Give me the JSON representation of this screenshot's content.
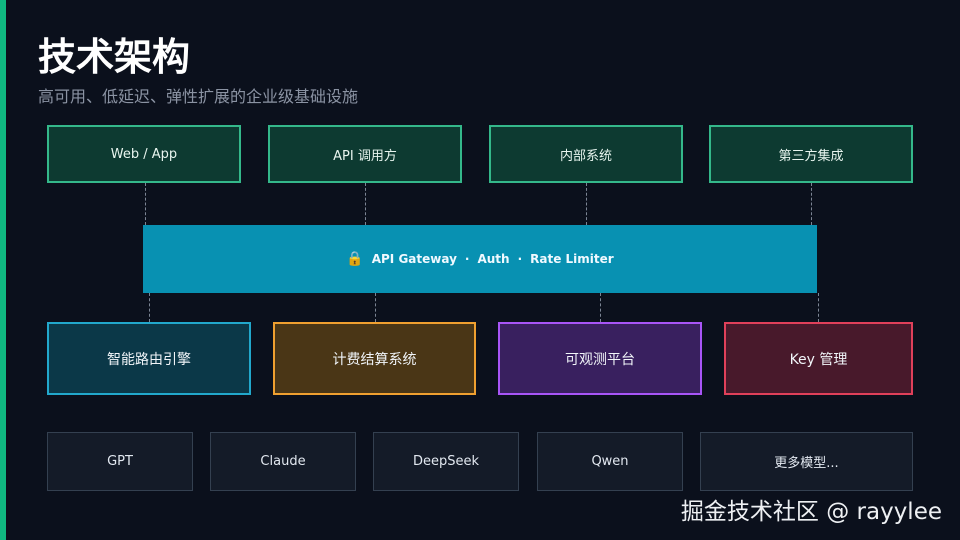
{
  "header": {
    "title": "技术架构",
    "subtitle": "高可用、低延迟、弹性扩展的企业级基础设施"
  },
  "clients": [
    "Web / App",
    "API 调用方",
    "内部系统",
    "第三方集成"
  ],
  "gateway": {
    "icon": "lock-icon",
    "parts": [
      "API Gateway",
      "·",
      "Auth",
      "·",
      "Rate Limiter"
    ]
  },
  "services": [
    {
      "label": "智能路由引擎",
      "border": "#22a8cc",
      "fill": "#0b3848"
    },
    {
      "label": "计费结算系统",
      "border": "#f0a030",
      "fill": "#4a3616"
    },
    {
      "label": "可观测平台",
      "border": "#a855f7",
      "fill": "#39205f"
    },
    {
      "label": "Key 管理",
      "border": "#e0405a",
      "fill": "#48192b"
    }
  ],
  "models": [
    "GPT",
    "Claude",
    "DeepSeek",
    "Qwen",
    "更多模型..."
  ],
  "watermark": "掘金技术社区 @ rayylee"
}
